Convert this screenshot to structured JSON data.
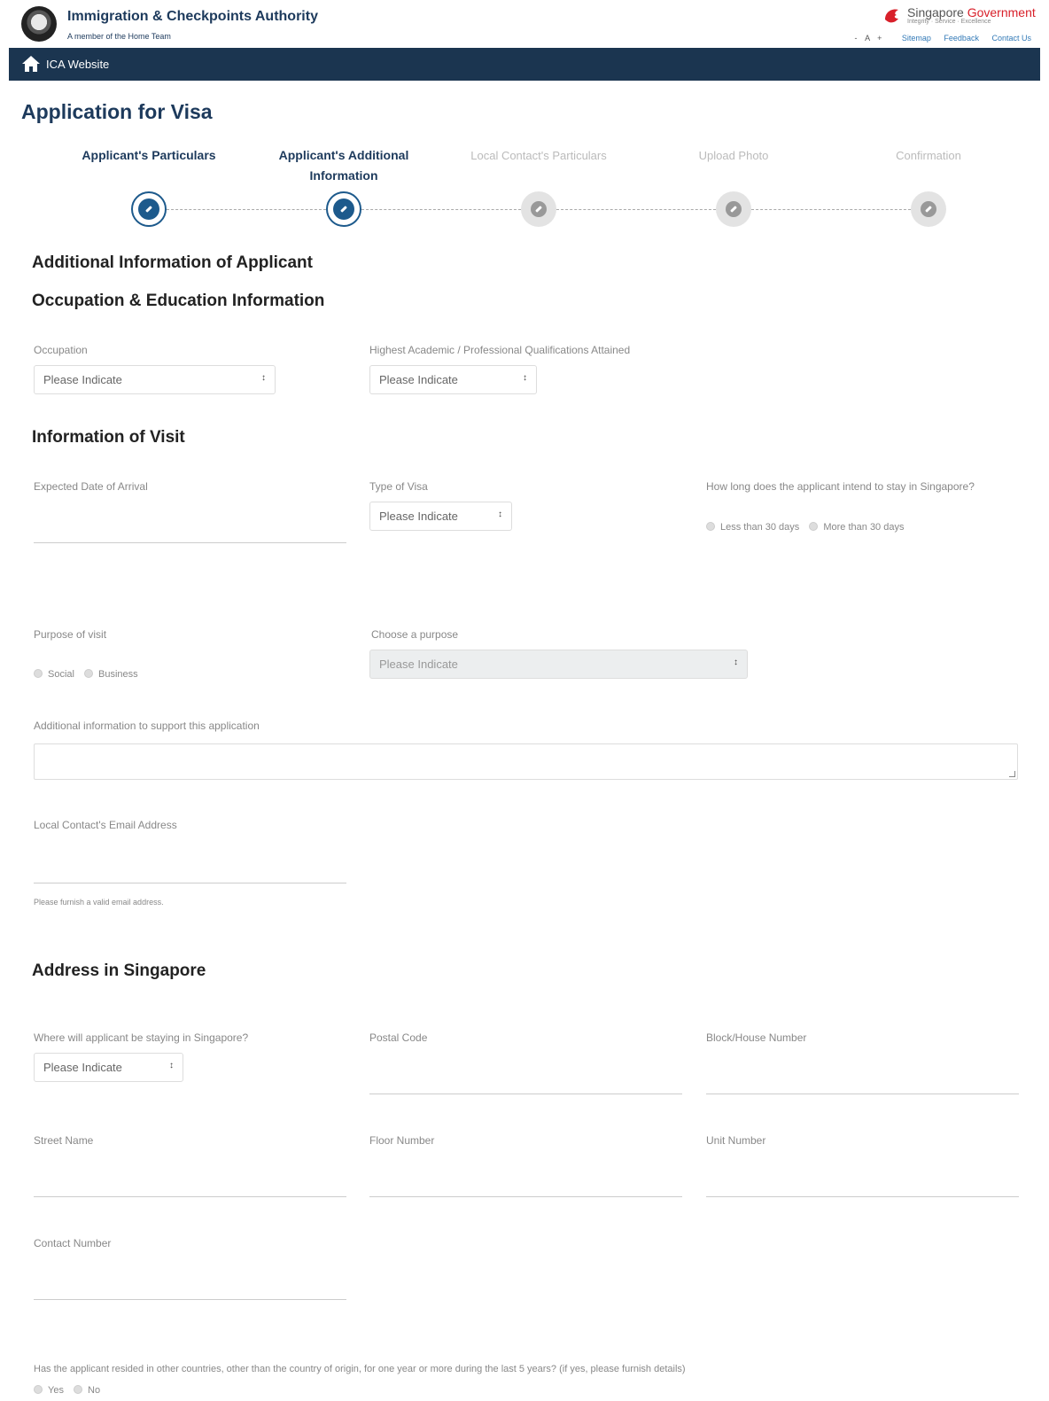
{
  "header": {
    "org_name": "Immigration & Checkpoints Authority",
    "org_sub": "A member of the Home Team",
    "gov_title_a": "Singapore ",
    "gov_title_b": "Government",
    "gov_tagline": "Integrity · Service · Excellence",
    "font_decrease": "-",
    "font_label": "A",
    "font_increase": "+",
    "links": [
      "Sitemap",
      "Feedback",
      "Contact Us"
    ]
  },
  "nav": {
    "home_label": "ICA Website"
  },
  "page_title": "Application for Visa",
  "steps": [
    {
      "label": "Applicant's Particulars",
      "state": "active"
    },
    {
      "label": "Applicant's Additional Information",
      "state": "active"
    },
    {
      "label": "Local Contact's Particulars",
      "state": "inactive"
    },
    {
      "label": "Upload Photo",
      "state": "inactive"
    },
    {
      "label": "Confirmation",
      "state": "inactive"
    }
  ],
  "sections": {
    "additional": "Additional Information of Applicant",
    "occupation": "Occupation & Education Information",
    "visit": "Information of Visit",
    "address": "Address in Singapore"
  },
  "fields": {
    "occupation_label": "Occupation",
    "occupation_value": "Please Indicate",
    "qualification_label": "Highest Academic / Professional Qualifications Attained",
    "qualification_value": "Please Indicate",
    "arrival_label": "Expected Date of Arrival",
    "visa_type_label": "Type of Visa",
    "visa_type_value": "Please Indicate",
    "stay_label": "How long does the applicant intend to stay in Singapore?",
    "stay_options": [
      "Less than 30 days",
      "More than 30 days"
    ],
    "purpose_label": "Purpose of visit",
    "purpose_options": [
      "Social",
      "Business"
    ],
    "choose_purpose_label": "Choose a purpose",
    "choose_purpose_value": "Please Indicate",
    "additional_info_label": "Additional information to support this application",
    "email_label": "Local Contact's Email Address",
    "email_hint": "Please furnish a valid email address.",
    "staying_label": "Where will applicant be staying in Singapore?",
    "staying_value": "Please Indicate",
    "postal_label": "Postal Code",
    "block_label": "Block/House Number",
    "street_label": "Street Name",
    "floor_label": "Floor Number",
    "unit_label": "Unit Number",
    "contact_label": "Contact Number",
    "resided_label": "Has the applicant resided in other countries, other than the country of origin, for one year or more during the last 5 years?  (if yes, please furnish details)",
    "resided_options": [
      "Yes",
      "No"
    ]
  },
  "colors": {
    "navbar": "#1b3550",
    "accent": "#1d5a8c",
    "gov_red": "#d8202a"
  }
}
